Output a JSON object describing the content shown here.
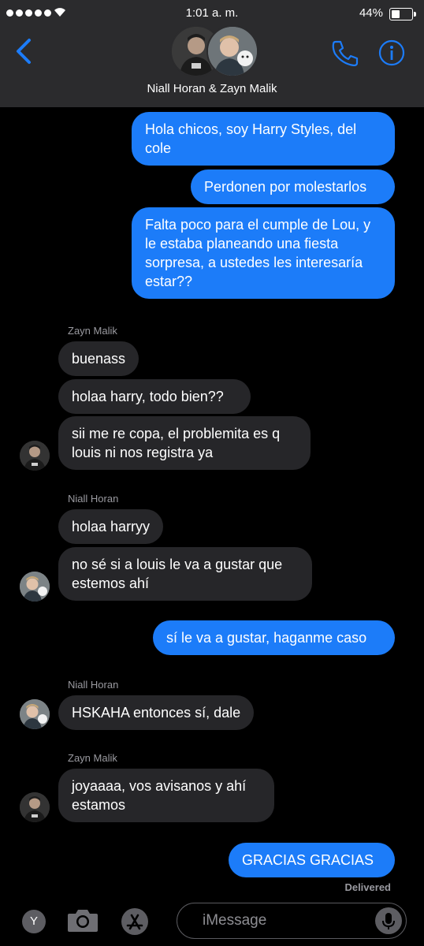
{
  "status_bar": {
    "time": "1:01 a. m.",
    "battery": "44%",
    "battery_level": 0.44
  },
  "header": {
    "title": "Niall Horan & Zayn Malik",
    "accent_color": "#1c7cf9"
  },
  "messages": [
    {
      "from": "me",
      "text": "Hola chicos, soy Harry Styles, del cole"
    },
    {
      "from": "me",
      "text": "Perdonen por molestarlos"
    },
    {
      "from": "me",
      "text": "Falta poco para el cumple de Lou, y le estaba planeando una fiesta sorpresa, a ustedes les interesaría estar??"
    },
    {
      "from": "Zayn Malik",
      "sender_label": "Zayn Malik",
      "text": "buenass"
    },
    {
      "from": "Zayn Malik",
      "text": "holaa harry, todo bien??"
    },
    {
      "from": "Zayn Malik",
      "text": "sii me re copa, el problemita es q louis ni nos registra ya"
    },
    {
      "from": "Niall Horan",
      "sender_label": "Niall Horan",
      "text": "holaa harryy"
    },
    {
      "from": "Niall Horan",
      "text": "no sé si a louis le va a gustar que estemos ahí"
    },
    {
      "from": "me",
      "text": "sí le va a gustar, haganme caso"
    },
    {
      "from": "Niall Horan",
      "sender_label": "Niall Horan",
      "text": "HSKAHA entonces sí, dale"
    },
    {
      "from": "Zayn Malik",
      "sender_label": "Zayn Malik",
      "text": "joyaaaa, vos avisanos y ahí estamos"
    },
    {
      "from": "me",
      "text": "GRACIAS GRACIAS"
    }
  ],
  "delivered_label": "Delivered",
  "input_bar": {
    "keyboard_key": "Y",
    "placeholder": "iMessage"
  },
  "colors": {
    "outgoing_bubble": "#1c7cf9",
    "incoming_bubble": "#262629",
    "background": "#000000"
  }
}
